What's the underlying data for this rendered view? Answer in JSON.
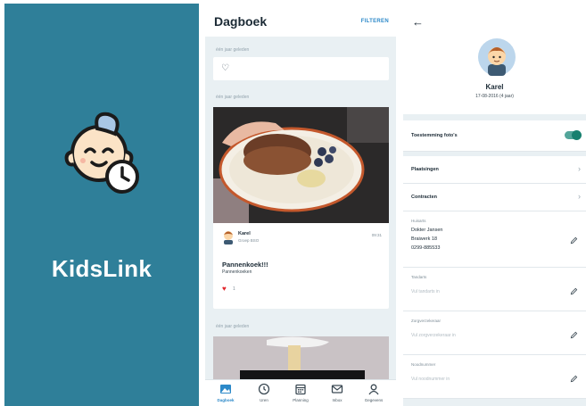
{
  "splash": {
    "brand": "KidsLink",
    "logo_icon": "baby-clock-icon",
    "background": "#2f7f99"
  },
  "diary": {
    "title": "Dagboek",
    "filter_label": "FILTEREN",
    "entries": [
      {
        "date": "één jaar geleden",
        "icon": "heart-outline-icon"
      },
      {
        "date": "één jaar geleden",
        "author_name": "Karel",
        "author_group": "Groep BSO",
        "time": "09:31",
        "title": "Pannenkoek!!!",
        "subtitle": "Pannenkoeken",
        "likes": "1"
      },
      {
        "date": "één jaar geleden"
      }
    ],
    "tabs": [
      {
        "label": "Dagboek",
        "icon": "photo-icon",
        "active": true
      },
      {
        "label": "Uren",
        "icon": "clock-icon",
        "active": false
      },
      {
        "label": "Planning",
        "icon": "calendar-icon",
        "active": false
      },
      {
        "label": "Inbox",
        "icon": "envelope-icon",
        "active": false
      },
      {
        "label": "Gegevens",
        "icon": "person-icon",
        "active": false
      }
    ],
    "accent": "#2c89c9"
  },
  "profile": {
    "name": "Karel",
    "dob": "17-08-2016 (4 jaar)",
    "photo_consent_label": "Toestemming foto's",
    "photo_consent_on": true,
    "links": [
      "Plaatsingen",
      "Contracten"
    ],
    "fields": [
      {
        "label": "Huisarts",
        "values": [
          "Dokter Jansen",
          "Braiwerk 18",
          "0299-885533"
        ],
        "placeholder": ""
      },
      {
        "label": "Tandarts",
        "values": [],
        "placeholder": "Vul tandarts in"
      },
      {
        "label": "Zorgverzekeraar",
        "values": [],
        "placeholder": "Vul zorgverzekeraar in"
      },
      {
        "label": "Noodnummer",
        "values": [],
        "placeholder": "Vul noodnummer in"
      }
    ],
    "toggle_color": "#17806f"
  }
}
